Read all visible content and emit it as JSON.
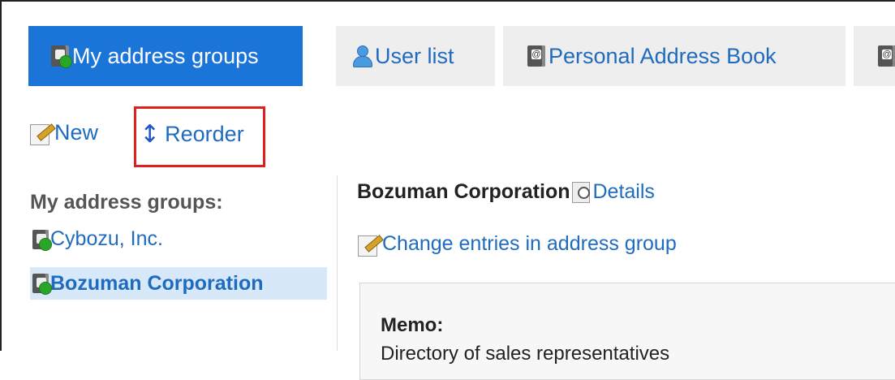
{
  "tabs": [
    {
      "label": "My address groups",
      "icon": "address-group-icon",
      "active": true
    },
    {
      "label": "User list",
      "icon": "user-icon",
      "active": false
    },
    {
      "label": "Personal Address Book",
      "icon": "address-book-icon",
      "active": false
    }
  ],
  "actions": {
    "new_label": "New",
    "reorder_label": "Reorder"
  },
  "sidebar": {
    "heading": "My address groups:",
    "items": [
      {
        "label": "Cybozu, Inc.",
        "selected": false
      },
      {
        "label": "Bozuman Corporation",
        "selected": true
      }
    ]
  },
  "content": {
    "group_name": "Bozuman Corporation",
    "details_label": "Details",
    "change_entries_label": "Change entries in address group",
    "memo_label": "Memo:",
    "memo_text": "Directory of sales representatives"
  },
  "colors": {
    "accent": "#1b74d8",
    "link": "#1f6bbf",
    "highlight": "#e0201c",
    "selected_bg": "#d7e8f8"
  }
}
